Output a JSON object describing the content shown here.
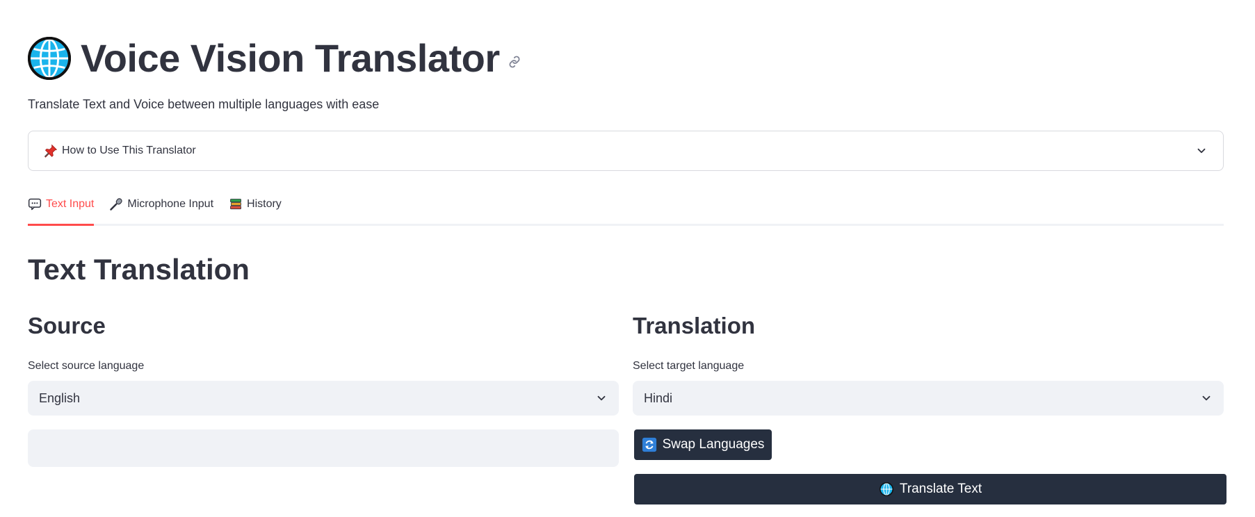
{
  "header": {
    "title": "Voice Vision Translator",
    "title_icon": "globe-icon",
    "subtitle": "Translate Text and Voice between multiple languages with ease"
  },
  "expander": {
    "icon": "pushpin-icon",
    "label": "How to Use This Translator"
  },
  "tabs": [
    {
      "label": "Text Input",
      "icon": "speech-bubble-icon",
      "active": true
    },
    {
      "label": "Microphone Input",
      "icon": "microphone-icon",
      "active": false
    },
    {
      "label": "History",
      "icon": "books-icon",
      "active": false
    }
  ],
  "main": {
    "heading": "Text Translation",
    "source": {
      "heading": "Source",
      "select_label": "Select source language",
      "selected": "English",
      "text_value": ""
    },
    "translation": {
      "heading": "Translation",
      "select_label": "Select target language",
      "selected": "Hindi",
      "swap_label": "Swap Languages",
      "translate_label": "Translate Text"
    }
  },
  "colors": {
    "accent": "#ff4b4b",
    "button_bg": "#262f3f",
    "input_bg": "#f0f2f6",
    "text": "#31333f"
  }
}
